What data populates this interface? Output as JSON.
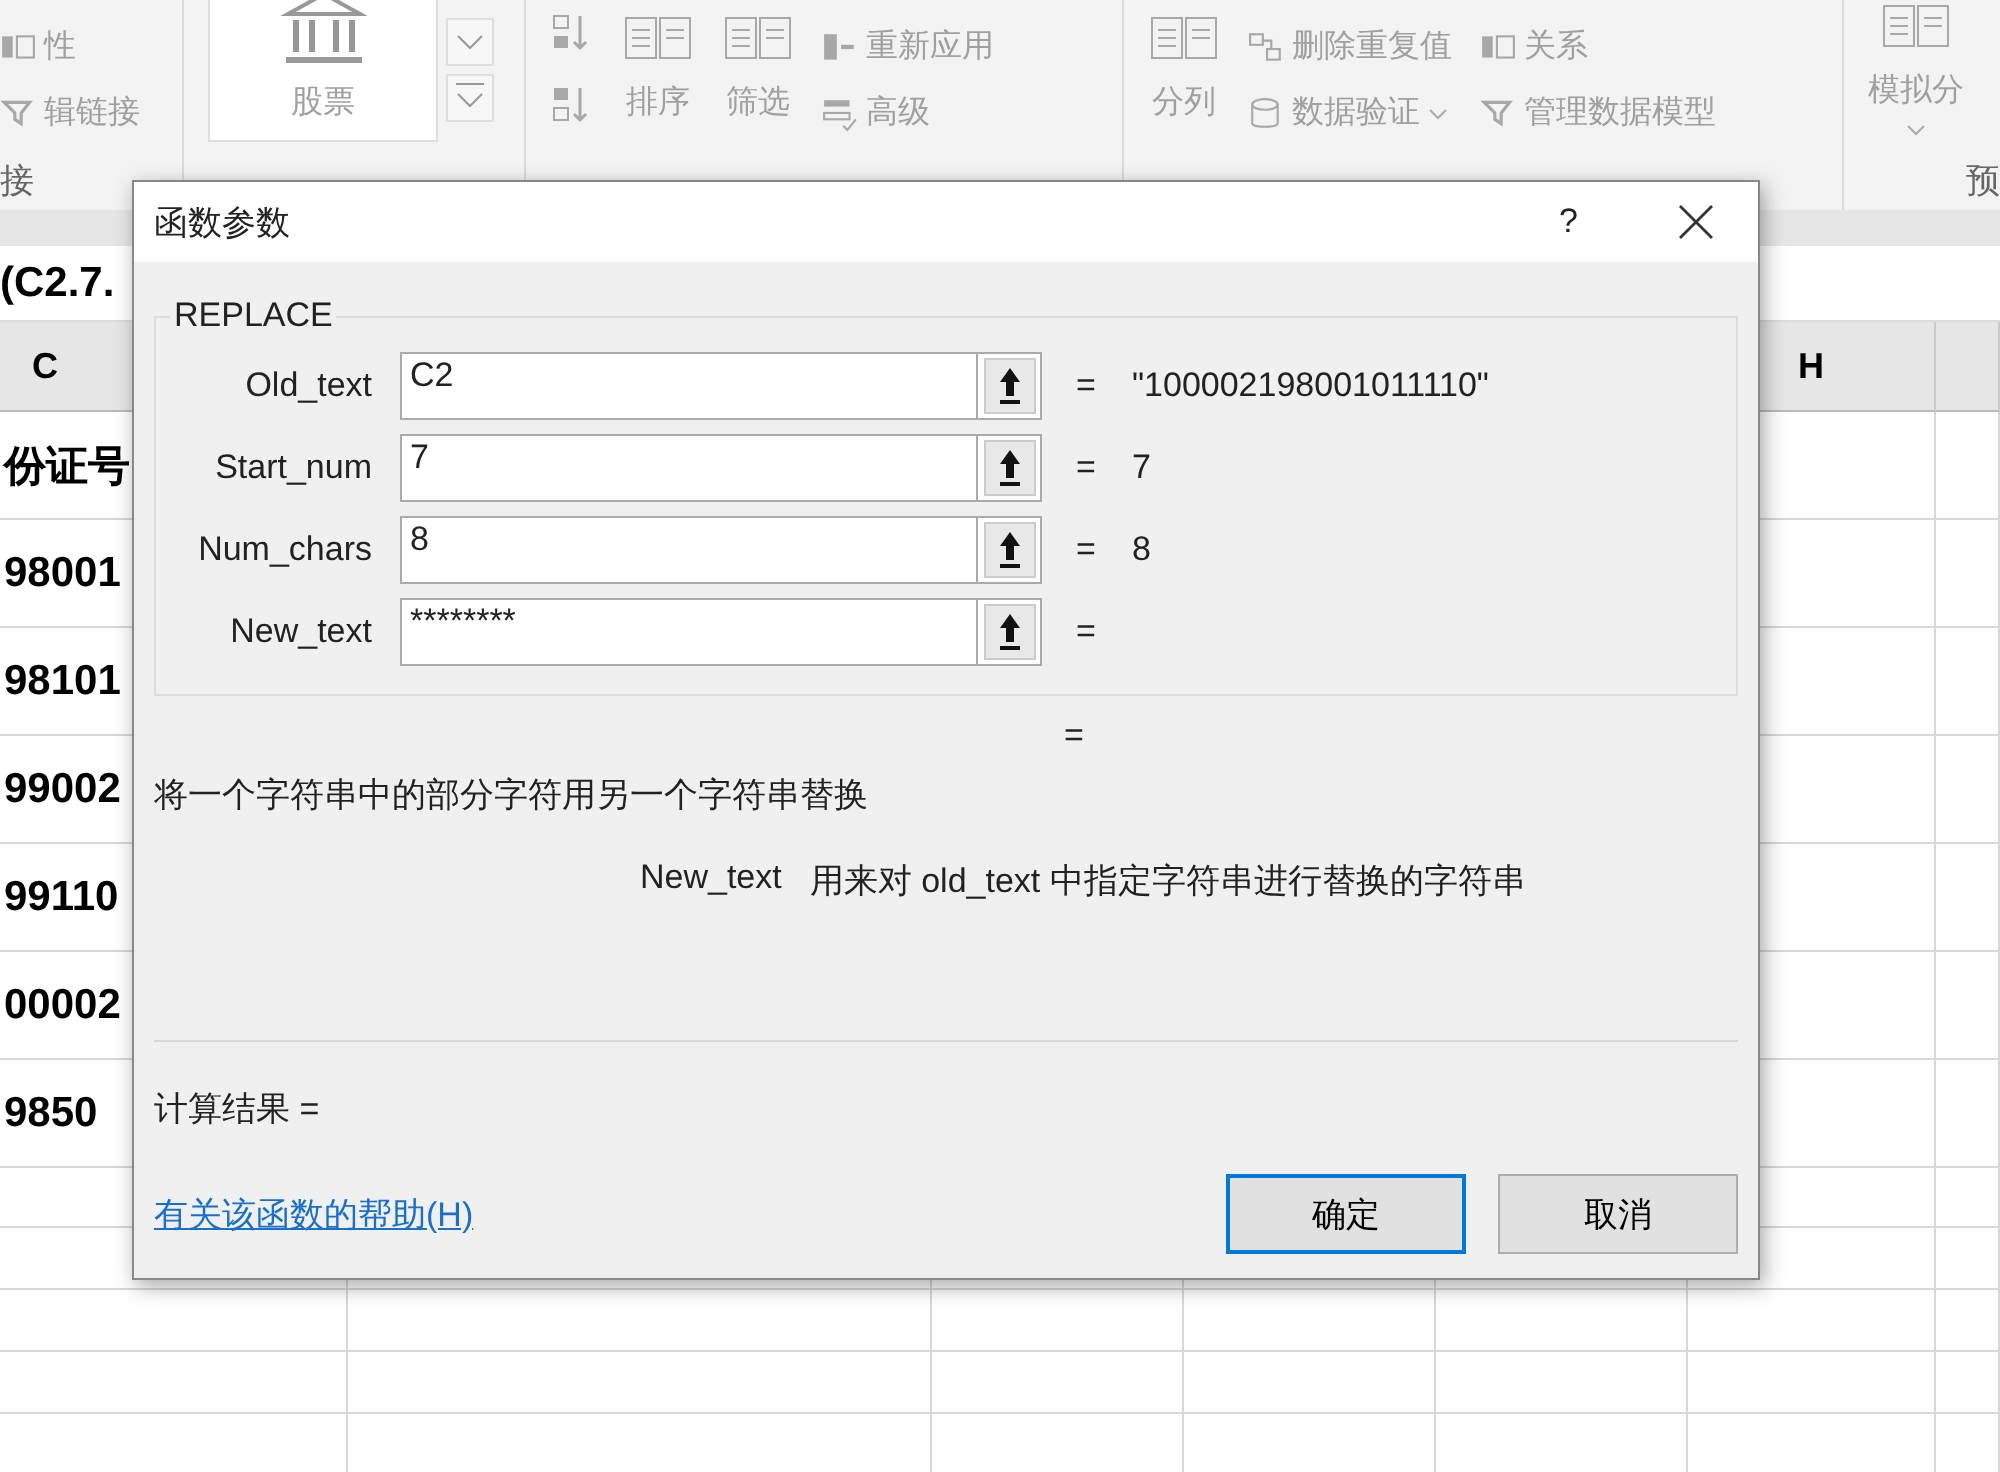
{
  "ribbon": {
    "groups": [
      {
        "columns": [
          [
            {
              "label": "性",
              "kind": "small"
            },
            {
              "label": "辑链接",
              "kind": "small"
            }
          ]
        ],
        "label": "接"
      },
      {
        "columns": [
          [
            {
              "label": "股票",
              "kind": "gallery"
            }
          ]
        ]
      },
      {
        "columns": [
          [
            {
              "kind": "sort"
            }
          ],
          [
            {
              "label": "排序",
              "kind": "large"
            }
          ],
          [
            {
              "label": "筛选",
              "kind": "large"
            }
          ],
          [
            {
              "label": "重新应用",
              "kind": "small"
            },
            {
              "label": "高级",
              "kind": "small"
            }
          ]
        ]
      },
      {
        "columns": [
          [
            {
              "label": "分列",
              "kind": "large"
            }
          ],
          [
            {
              "label": "删除重复值",
              "kind": "small"
            },
            {
              "label": "数据验证",
              "kind": "small-dropdown"
            }
          ],
          [
            {
              "label": "关系",
              "kind": "small"
            },
            {
              "label": "管理数据模型",
              "kind": "small"
            }
          ]
        ]
      },
      {
        "columns": [
          [
            {
              "label": "模拟分",
              "kind": "large-dropdown"
            }
          ]
        ],
        "label": "预"
      }
    ]
  },
  "formula_bar": {
    "text": "(C2.7."
  },
  "sheet": {
    "column_headers": [
      "C",
      "H"
    ],
    "column_c_cells": [
      "份证号",
      "98001",
      "98101",
      "99002",
      "99110",
      "00002",
      "9850"
    ]
  },
  "dialog": {
    "title": "函数参数",
    "help": "?",
    "function_name": "REPLACE",
    "args": [
      {
        "label": "Old_text",
        "value": "C2",
        "equals": "=",
        "result": "\"100002198001011110\""
      },
      {
        "label": "Start_num",
        "value": "7",
        "equals": "=",
        "result": "7"
      },
      {
        "label": "Num_chars",
        "value": "8",
        "equals": "=",
        "result": "8"
      },
      {
        "label": "New_text",
        "value": "********",
        "equals": "="
      }
    ],
    "formula_equals": "=",
    "description": "将一个字符串中的部分字符用另一个字符串替换",
    "arg_help": {
      "name": "New_text",
      "text": "用来对 old_text 中指定字符串进行替换的字符串"
    },
    "result_label": "计算结果 =",
    "help_link": "有关该函数的帮助(H)",
    "buttons": [
      {
        "label": "确定",
        "focused": true
      },
      {
        "label": "取消",
        "focused": false
      }
    ]
  }
}
